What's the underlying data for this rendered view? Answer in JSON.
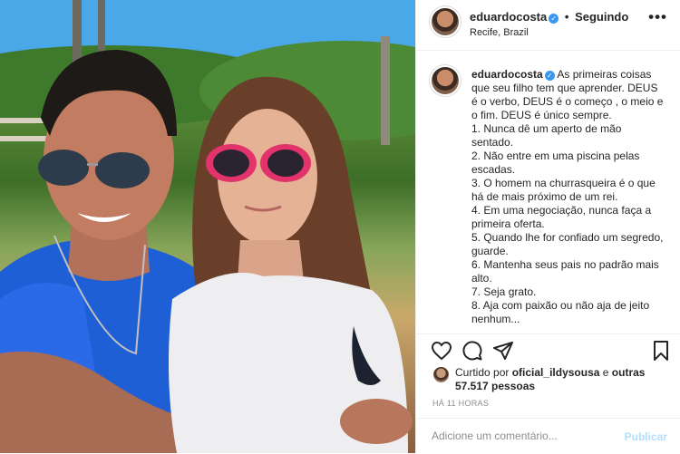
{
  "post": {
    "photo": {
      "description_icon": "photo-icon"
    },
    "header": {
      "username": "eduardocosta",
      "separator": "•",
      "following": "Seguindo",
      "location": "Recife, Brazil",
      "more": "•••"
    },
    "caption": {
      "username": "eduardocosta",
      "text": "As primeiras coisas que seu filho tem que aprender. DEUS é o verbo, DEUS é o começo , o meio e o fim. DEUS é único sempre.\n1. Nunca dê um aperto de mão sentado.\n2. Não entre em uma piscina pelas escadas.\n3. O homem na churrasqueira é o que há de mais próximo de um rei.\n4. Em uma negociação, nunca faça a primeira oferta.\n5. Quando lhe for confiado um segredo, guarde.\n6. Mantenha seus pais no padrão mais alto.\n7. Seja grato.\n8. Aja com paixão ou não aja de jeito nenhum..."
    },
    "actions": {
      "like_icon": "heart-icon",
      "comment_icon": "comment-icon",
      "share_icon": "share-icon",
      "save_icon": "bookmark-icon"
    },
    "likes": {
      "prefix": "Curtido por",
      "user": "oficial_ildysousa",
      "and": "e",
      "others": "outras 57.517 pessoas"
    },
    "timestamp": "HÁ 11 HORAS",
    "comment": {
      "placeholder": "Adicione um comentário...",
      "publish": "Publicar"
    }
  },
  "colors": {
    "verified": "#3897f0",
    "publish_disabled": "#b2dffc",
    "secondary_text": "#8e8e8e",
    "border": "#efefef"
  }
}
